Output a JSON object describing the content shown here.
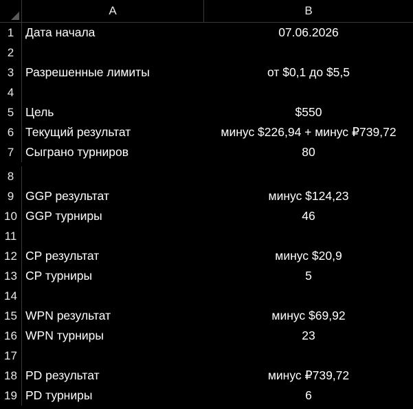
{
  "columns": {
    "a": "A",
    "b": "B"
  },
  "rows": [
    {
      "num": "1",
      "a": "Дата начала",
      "b": "07.06.2026"
    },
    {
      "num": "2",
      "a": "",
      "b": ""
    },
    {
      "num": "3",
      "a": "Разрешенные лимиты",
      "b": "от $0,1 до $5,5"
    },
    {
      "num": "4",
      "a": "",
      "b": ""
    },
    {
      "num": "5",
      "a": "Цель",
      "b": "$550"
    },
    {
      "num": "6",
      "a": "Текущий результат",
      "b": "минус $226,94 + минус ₽739,72"
    },
    {
      "num": "7",
      "a": "Сыграно турниров",
      "b": "80"
    },
    {
      "num": "8",
      "a": "",
      "b": ""
    },
    {
      "num": "9",
      "a": "GGP результат",
      "b": "минус $124,23"
    },
    {
      "num": "10",
      "a": "GGP турниры",
      "b": "46"
    },
    {
      "num": "11",
      "a": "",
      "b": ""
    },
    {
      "num": "12",
      "a": "CP результат",
      "b": "минус $20,9"
    },
    {
      "num": "13",
      "a": "CP турниры",
      "b": "5"
    },
    {
      "num": "14",
      "a": "",
      "b": ""
    },
    {
      "num": "15",
      "a": "WPN результат",
      "b": "минус $69,92"
    },
    {
      "num": "16",
      "a": "WPN турниры",
      "b": "23"
    },
    {
      "num": "17",
      "a": "",
      "b": ""
    },
    {
      "num": "18",
      "a": "PD результат",
      "b": "минус ₽739,72"
    },
    {
      "num": "19",
      "a": "PD турниры",
      "b": "6"
    }
  ]
}
